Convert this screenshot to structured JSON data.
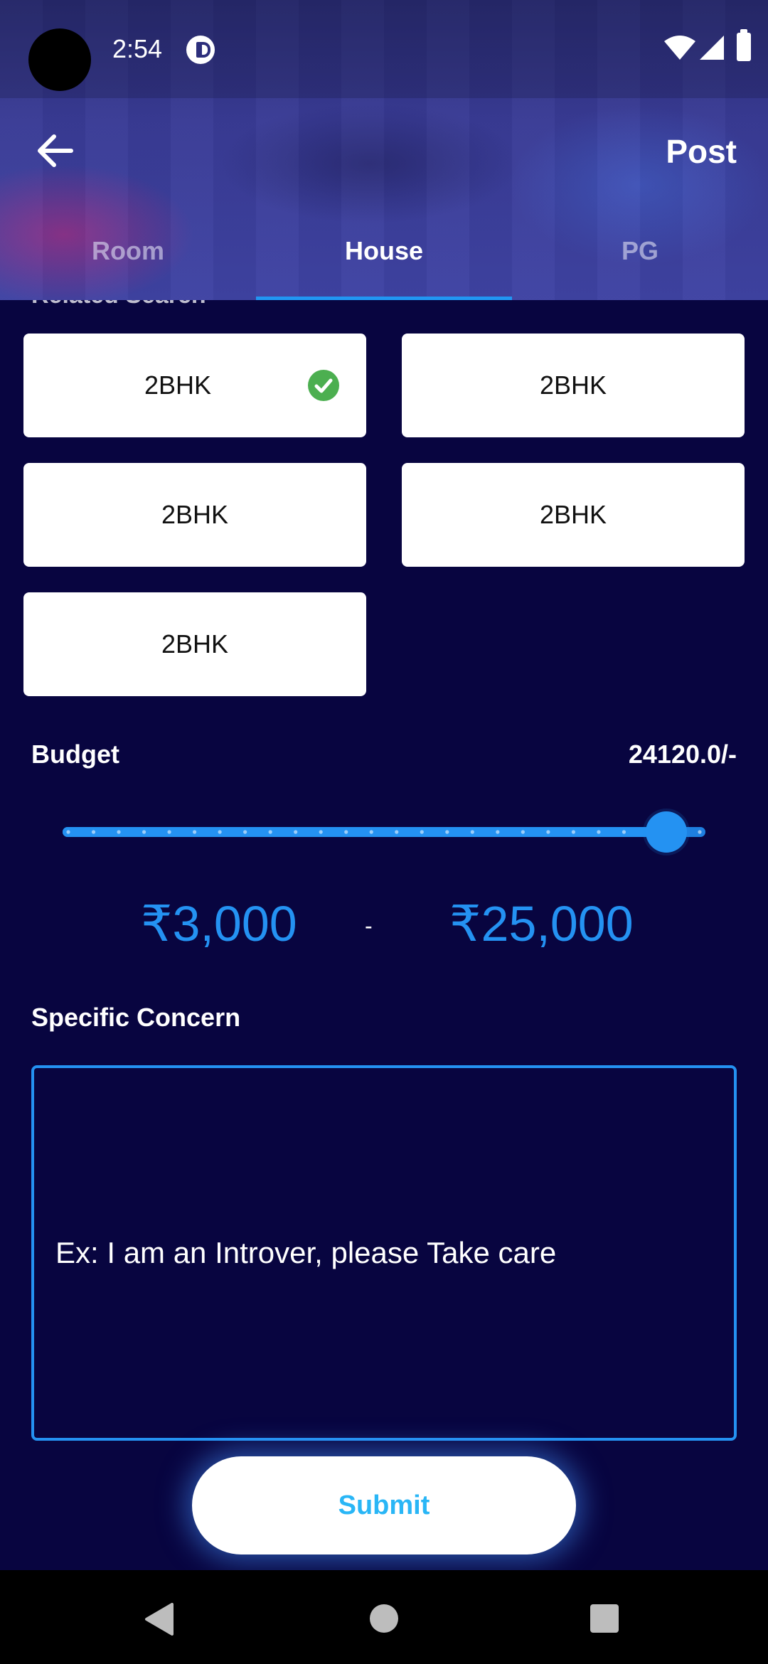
{
  "status_bar": {
    "time": "2:54",
    "icons": [
      "camera-cutout",
      "sync-icon",
      "wifi-icon",
      "signal-icon",
      "battery-icon"
    ]
  },
  "app_bar": {
    "back_icon": "arrow-left-icon",
    "post_label": "Post"
  },
  "tabs": [
    {
      "label": "Room",
      "active": false
    },
    {
      "label": "House",
      "active": true
    },
    {
      "label": "PG",
      "active": false
    }
  ],
  "related_search": {
    "heading": "Related Search",
    "options": [
      {
        "label": "2BHK",
        "selected": true
      },
      {
        "label": "2BHK",
        "selected": false
      },
      {
        "label": "2BHK",
        "selected": false
      },
      {
        "label": "2BHK",
        "selected": false
      },
      {
        "label": "2BHK",
        "selected": false
      }
    ],
    "selected_icon": "check-circle-icon"
  },
  "budget": {
    "label": "Budget",
    "value_text": "24120.0/-",
    "slider": {
      "min": 3000,
      "max": 25000,
      "value": 24120,
      "ticks": 26
    },
    "min_text": "₹3,000",
    "separator": "-",
    "max_text": "₹25,000"
  },
  "concern": {
    "label": "Specific Concern",
    "placeholder": "Ex: I am an Introver, please Take care",
    "value": ""
  },
  "submit": {
    "label": "Submit"
  },
  "nav_bar": {
    "icons": [
      "nav-back-icon",
      "nav-home-icon",
      "nav-recents-icon"
    ]
  },
  "colors": {
    "background": "#080540",
    "accent": "#2492f2",
    "submit_text": "#29b6f6",
    "check": "#4caf50"
  }
}
